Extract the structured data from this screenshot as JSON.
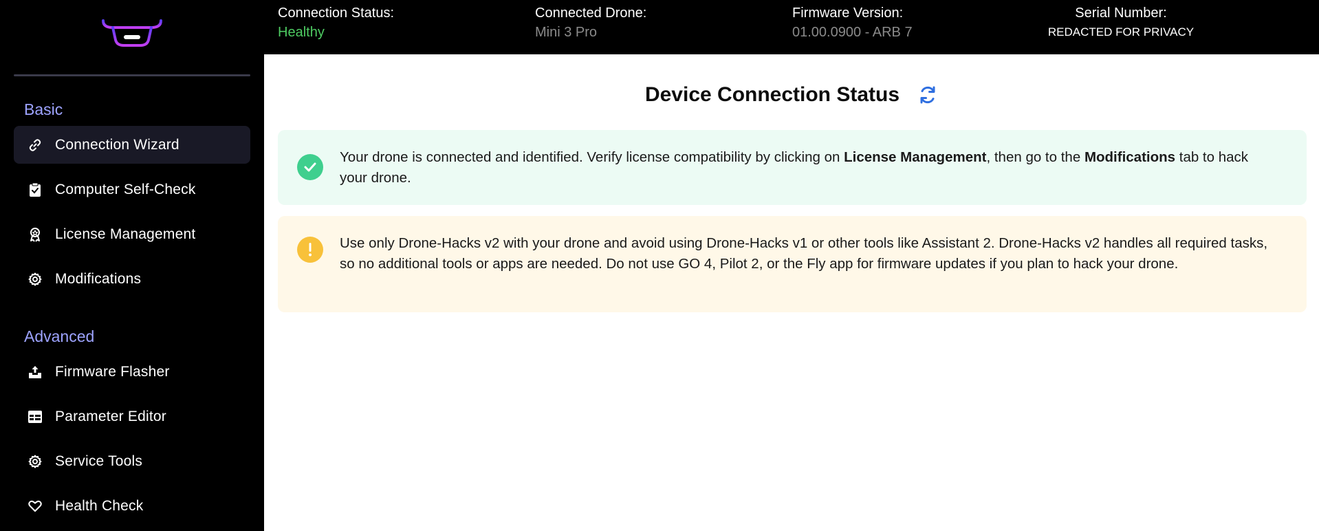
{
  "topbar": {
    "connection_status": {
      "title": "Connection Status:",
      "value": "Healthy"
    },
    "connected_drone": {
      "title": "Connected Drone:",
      "value": "Mini 3 Pro"
    },
    "firmware_version": {
      "title": "Firmware Version:",
      "value": "01.00.0900 - ARB 7"
    },
    "serial_number": {
      "title": "Serial Number:",
      "value": "REDACTED FOR PRIVACY"
    }
  },
  "sidebar": {
    "sections": {
      "basic": "Basic",
      "advanced": "Advanced"
    },
    "items": [
      {
        "label": "Connection Wizard",
        "icon": "link-icon",
        "active": true
      },
      {
        "label": "Computer Self-Check",
        "icon": "clipboard-check-icon"
      },
      {
        "label": "License Management",
        "icon": "award-icon"
      },
      {
        "label": "Modifications",
        "icon": "gear-icon"
      },
      {
        "label": "Firmware Flasher",
        "icon": "upload-tray-icon"
      },
      {
        "label": "Parameter Editor",
        "icon": "table-icon"
      },
      {
        "label": "Service Tools",
        "icon": "gear-icon"
      },
      {
        "label": "Health Check",
        "icon": "heart-icon"
      }
    ]
  },
  "main": {
    "title": "Device Connection Status",
    "refresh_icon": "refresh-icon",
    "success_alert": {
      "icon": "check-circle-icon",
      "text_1": "Your drone is connected and identified. Verify license compatibility by clicking on ",
      "bold_1": "License Management",
      "text_2": ", then go to the ",
      "bold_2": "Modifications",
      "text_3": " tab to hack your drone."
    },
    "warning_alert": {
      "icon": "exclamation-circle-icon",
      "text": "Use only Drone-Hacks v2 with your drone and avoid using Drone-Hacks v1 or other tools like Assistant 2. Drone-Hacks v2 handles all required tasks, so no additional tools or apps are needed. Do not use GO 4, Pilot 2, or the Fly app for firmware updates if you plan to hack your drone."
    }
  },
  "colors": {
    "accent": "#9da3ff",
    "healthy": "#4ecb62",
    "success_bg": "#ecfbf4",
    "success_icon": "#3fcf8e",
    "warning_bg": "#fff8e8",
    "warning_icon": "#f8c13a",
    "refresh": "#2f6fe0"
  }
}
